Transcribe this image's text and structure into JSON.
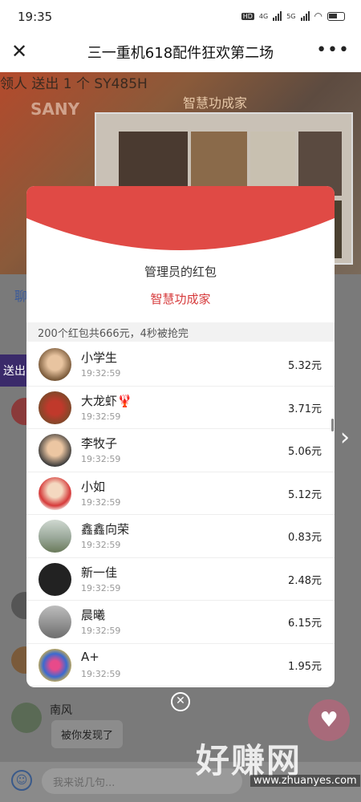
{
  "status_bar": {
    "time": "19:35",
    "net_label": "HD",
    "signal_1": "4G",
    "signal_2": "5G"
  },
  "nav": {
    "title": "三一重机618配件狂欢第二场"
  },
  "video": {
    "marquee": "领人 送出 1 个 SY485H",
    "logo": "SANY",
    "slide_title": "智慧功成家"
  },
  "background": {
    "side_text": "聊",
    "send_chip": "送出",
    "chat_name": "南风",
    "chat_message": "被你发现了",
    "input_placeholder": "我来说几句...",
    "watermark": "好赚网",
    "watermark_url": "www.zhuanyes.com"
  },
  "modal": {
    "owner": "管理员的红包",
    "blessing": "智慧功成家",
    "summary": "200个红包共666元，4秒被抢完",
    "rows": [
      {
        "name": "小学生",
        "time": "19:32:59",
        "amount": "5.32元",
        "avatar": "photo-child"
      },
      {
        "name": "大龙虾🦞",
        "time": "19:32:59",
        "amount": "3.71元",
        "avatar": "photo-lobster"
      },
      {
        "name": "李牧子",
        "time": "19:32:59",
        "amount": "5.06元",
        "avatar": "photo-child"
      },
      {
        "name": "小如",
        "time": "19:32:59",
        "amount": "5.12元",
        "avatar": "photo-girl"
      },
      {
        "name": "鑫鑫向荣",
        "time": "19:32:59",
        "amount": "0.83元",
        "avatar": "photo-tower"
      },
      {
        "name": "新一佳",
        "time": "19:32:59",
        "amount": "2.48元",
        "avatar": "photo-logo"
      },
      {
        "name": "晨曦",
        "time": "19:32:59",
        "amount": "6.15元",
        "avatar": "photo-car"
      },
      {
        "name": "A+",
        "time": "19:32:59",
        "amount": "1.95元",
        "avatar": "photo-colorful"
      }
    ]
  },
  "colors": {
    "red": "#d6393a",
    "header_red": "#e04a45"
  }
}
